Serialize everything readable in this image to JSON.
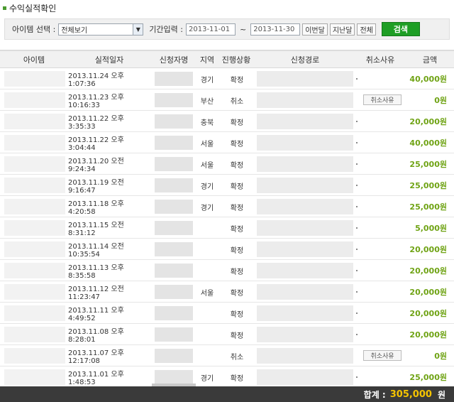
{
  "page": {
    "title": "수익실적확인"
  },
  "filter": {
    "item_label": "아이템 선택 :",
    "item_value": "전체보기",
    "period_label": "기간입력 :",
    "date_from": "2013-11-01",
    "tilde": "~",
    "date_to": "2013-11-30",
    "this_month": "이번달",
    "last_month": "지난달",
    "all": "전체",
    "search": "검색"
  },
  "table": {
    "headers": [
      "아이템",
      "실적일자",
      "신청자명",
      "지역",
      "진행상황",
      "신청경로",
      "취소사유",
      "금액"
    ],
    "rows": [
      {
        "date": "2013.11.24 오후 1:07:36",
        "region": "경기",
        "status": "확정",
        "cancel": "",
        "amount": "40,000원"
      },
      {
        "date": "2013.11.23 오후 10:16:33",
        "region": "부산",
        "status": "취소",
        "cancel": "취소사유",
        "amount": "0원"
      },
      {
        "date": "2013.11.22 오후 3:35:33",
        "region": "충북",
        "status": "확정",
        "cancel": "",
        "amount": "20,000원"
      },
      {
        "date": "2013.11.22 오후 3:04:44",
        "region": "서울",
        "status": "확정",
        "cancel": "",
        "amount": "40,000원"
      },
      {
        "date": "2013.11.20 오전 9:24:34",
        "region": "서울",
        "status": "확정",
        "cancel": "",
        "amount": "25,000원"
      },
      {
        "date": "2013.11.19 오전 9:16:47",
        "region": "경기",
        "status": "확정",
        "cancel": "",
        "amount": "25,000원"
      },
      {
        "date": "2013.11.18 오후 4:20:58",
        "region": "경기",
        "status": "확정",
        "cancel": "",
        "amount": "25,000원"
      },
      {
        "date": "2013.11.15 오전 8:31:12",
        "region": "",
        "status": "확정",
        "cancel": "",
        "amount": "5,000원"
      },
      {
        "date": "2013.11.14 오전 10:35:54",
        "region": "",
        "status": "확정",
        "cancel": "",
        "amount": "20,000원"
      },
      {
        "date": "2013.11.13 오후 8:35:58",
        "region": "",
        "status": "확정",
        "cancel": "",
        "amount": "20,000원"
      },
      {
        "date": "2013.11.12 오전 11:23:47",
        "region": "서울",
        "status": "확정",
        "cancel": "",
        "amount": "20,000원"
      },
      {
        "date": "2013.11.11 오후 4:49:52",
        "region": "",
        "status": "확정",
        "cancel": "",
        "amount": "20,000원"
      },
      {
        "date": "2013.11.08 오후 8:28:01",
        "region": "",
        "status": "확정",
        "cancel": "",
        "amount": "20,000원"
      },
      {
        "date": "2013.11.07 오후 12:17:08",
        "region": "",
        "status": "취소",
        "cancel": "취소사유",
        "amount": "0원"
      },
      {
        "date": "2013.11.01 오후 1:48:53",
        "region": "경기",
        "status": "확정",
        "cancel": "",
        "amount": "25,000원"
      }
    ]
  },
  "footer": {
    "total_label": "합계 :",
    "total_value": "305,000",
    "total_unit": "원"
  },
  "colors": {
    "accent": "#1e9e25",
    "amount": "#6fa314",
    "total": "#f5c400",
    "footer_bg": "#3a3a3a"
  }
}
